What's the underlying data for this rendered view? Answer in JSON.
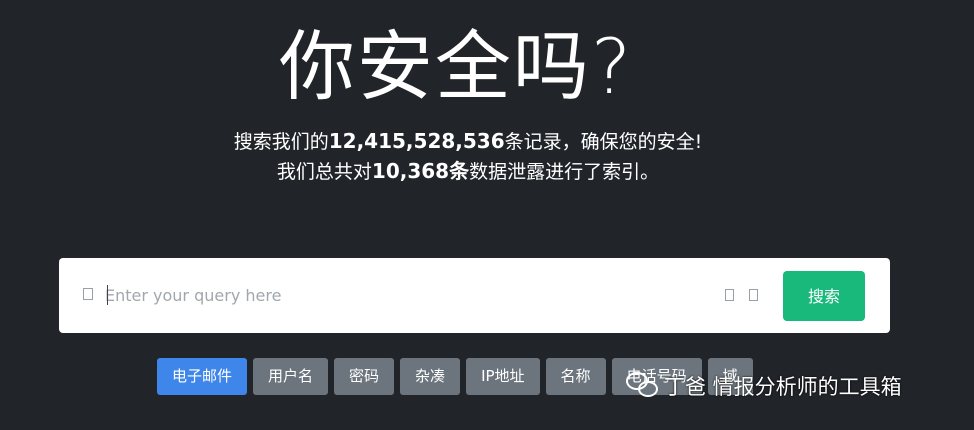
{
  "hero": {
    "title": "你安全吗?",
    "line1_prefix": "搜索我们的",
    "line1_count": "12,415,528,536",
    "line1_suffix": "条记录，确保您的安全!",
    "line2_prefix": "我们总共对",
    "line2_count": "10,368条",
    "line2_suffix": "数据泄露进行了索引。"
  },
  "search": {
    "placeholder": "Enter your query here",
    "value": "",
    "button_label": "搜索"
  },
  "tabs": [
    {
      "label": "电子邮件",
      "active": true
    },
    {
      "label": "用户名",
      "active": false
    },
    {
      "label": "密码",
      "active": false
    },
    {
      "label": "杂凑",
      "active": false
    },
    {
      "label": "IP地址",
      "active": false
    },
    {
      "label": "名称",
      "active": false
    },
    {
      "label": "电话号码",
      "active": false
    },
    {
      "label": "域",
      "active": false
    }
  ],
  "watermark": {
    "text": "丁爸 情报分析师的工具箱",
    "icon": "wechat-icon"
  },
  "colors": {
    "background": "#212429",
    "search_button": "#18b97a",
    "tab_active": "#3f86ea",
    "tab_default": "#6c757d"
  }
}
